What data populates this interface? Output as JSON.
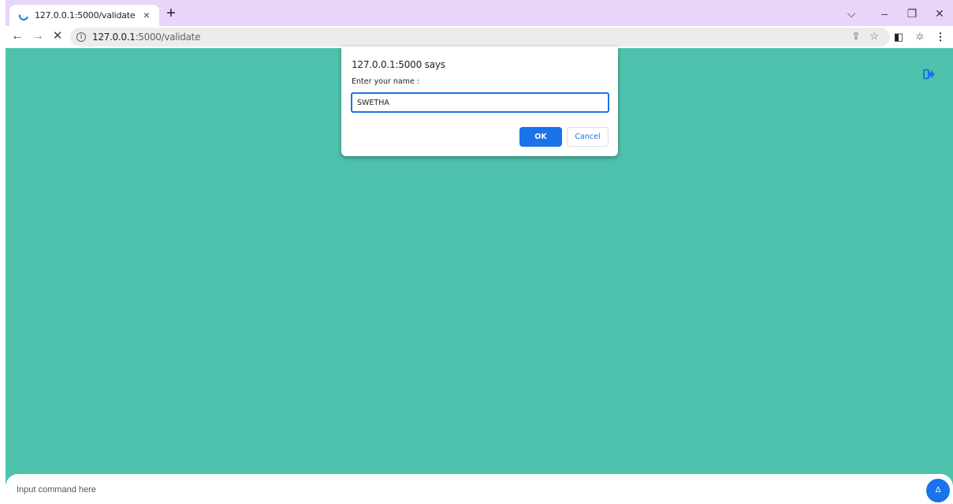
{
  "browser": {
    "tab": {
      "title": "127.0.0.1:5000/validate",
      "loading_icon": "loading-spinner-icon",
      "close_glyph": "×"
    },
    "new_tab_glyph": "+",
    "window_controls": {
      "tabsearch_glyph": "⌵",
      "minimize_glyph": "–",
      "restore_glyph": "❐",
      "close_glyph": "✕"
    },
    "toolbar": {
      "back_glyph": "←",
      "forward_glyph": "→",
      "stop_glyph": "✕",
      "url_host": "127.0.0.1",
      "url_path": ":5000/validate",
      "share_glyph": "⇪",
      "bookmark_glyph": "☆",
      "sidepanel_glyph": "◧",
      "extension_glyph": "✲",
      "menu_glyph": "⋮"
    }
  },
  "page": {
    "background_color": "#4fc2ae",
    "logout_icon": "sign-out-icon",
    "command_bar": {
      "placeholder": "Input command here",
      "send_glyph": "∆"
    }
  },
  "dialog": {
    "title": "127.0.0.1:5000 says",
    "message": "Enter your name :",
    "input_value": "SWETHA",
    "ok_label": "OK",
    "cancel_label": "Cancel"
  },
  "colors": {
    "tabstrip": "#e9d4fa",
    "accent": "#1a73e8"
  }
}
